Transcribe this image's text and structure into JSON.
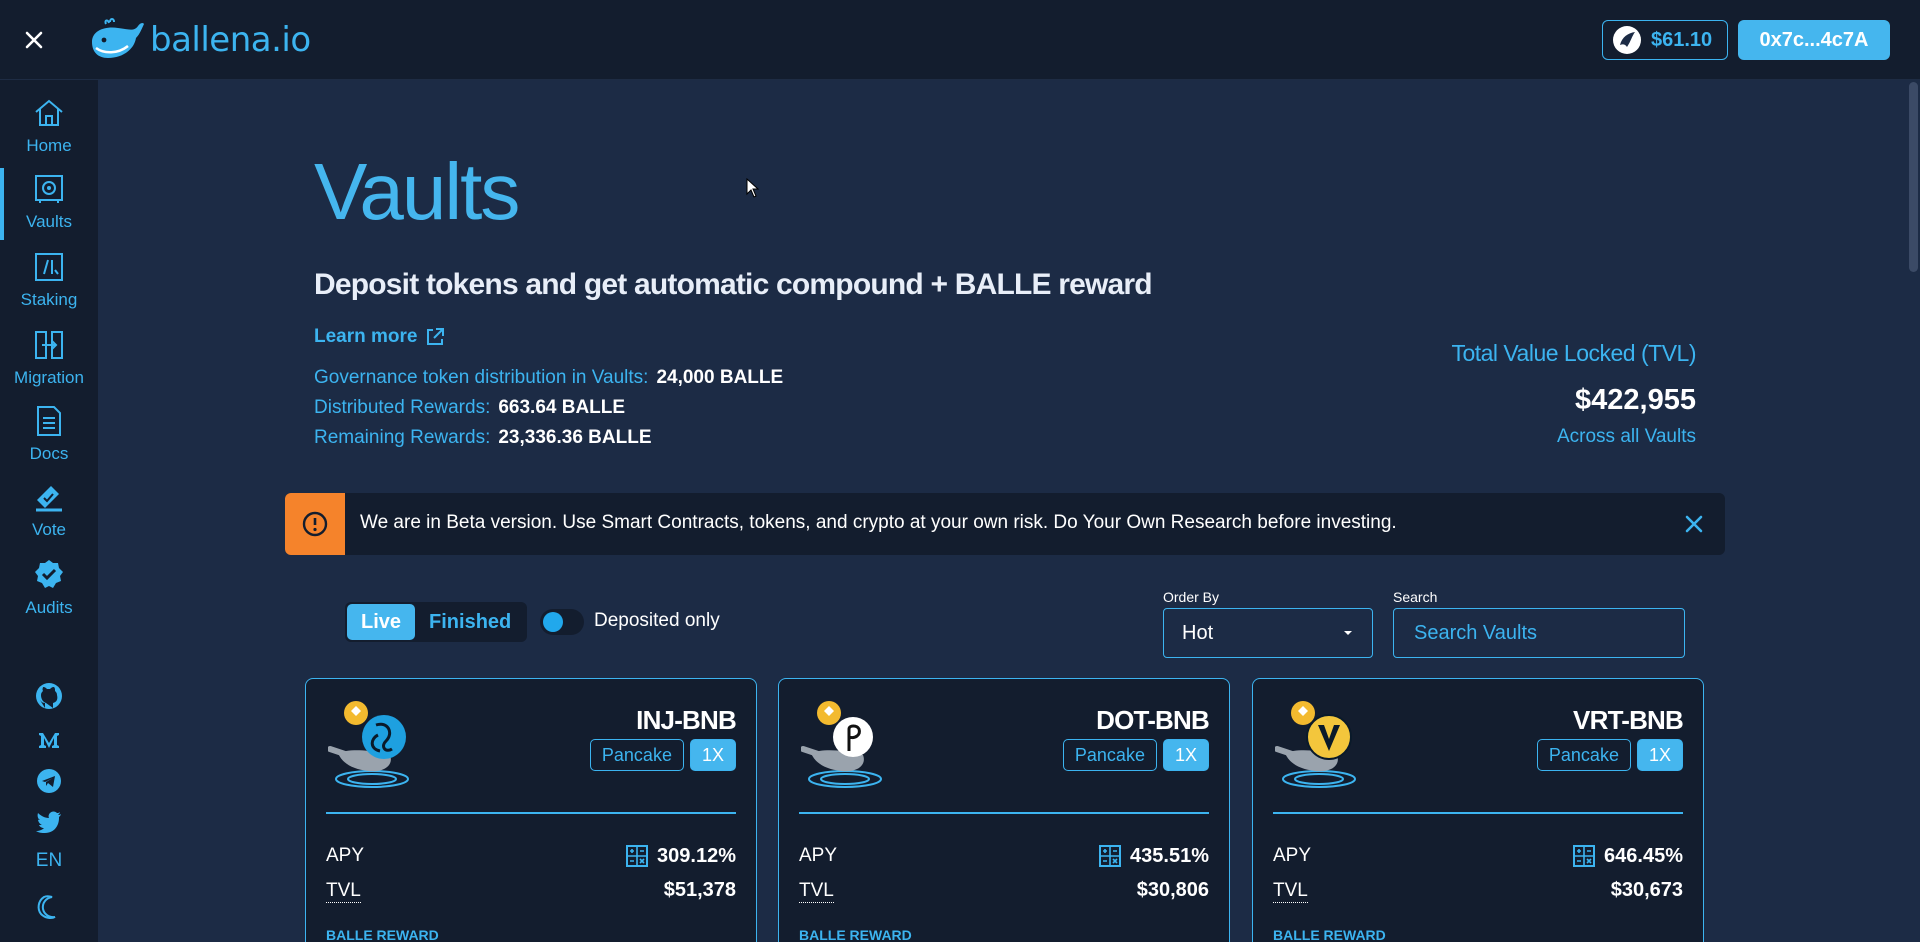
{
  "header": {
    "brand": "ballena.io",
    "price": "$61.10",
    "wallet": "0x7c...4c7A"
  },
  "sidebar": {
    "items": [
      {
        "label": "Home",
        "icon": "home-icon"
      },
      {
        "label": "Vaults",
        "icon": "vault-icon"
      },
      {
        "label": "Staking",
        "icon": "staking-icon"
      },
      {
        "label": "Migration",
        "icon": "migration-icon"
      },
      {
        "label": "Docs",
        "icon": "docs-icon"
      },
      {
        "label": "Vote",
        "icon": "vote-icon"
      },
      {
        "label": "Audits",
        "icon": "audits-icon"
      }
    ],
    "social": [
      "github-icon",
      "medium-icon",
      "telegram-icon",
      "twitter-icon"
    ],
    "language": "EN"
  },
  "page": {
    "title": "Vaults",
    "subtitle": "Deposit tokens and get automatic compound + BALLE reward",
    "learn_more": "Learn more",
    "stats": [
      {
        "label": "Governance token distribution in Vaults:",
        "value": "24,000 BALLE"
      },
      {
        "label": "Distributed Rewards:",
        "value": "663.64 BALLE"
      },
      {
        "label": "Remaining Rewards:",
        "value": "23,336.36 BALLE"
      }
    ],
    "tvl": {
      "label": "Total Value Locked (TVL)",
      "value": "$422,955",
      "sub": "Across all Vaults"
    }
  },
  "banner": {
    "text": "We are in Beta version. Use Smart Contracts, tokens, and crypto at your own risk. Do Your Own Research before investing."
  },
  "filters": {
    "live": "Live",
    "finished": "Finished",
    "deposited_only": "Deposited only",
    "order_by_label": "Order By",
    "order_by_value": "Hot",
    "search_label": "Search",
    "search_placeholder": "Search Vaults"
  },
  "vaults": [
    {
      "name": "INJ-BNB",
      "platform": "Pancake",
      "multiplier": "1X",
      "apy_label": "APY",
      "apy": "309.12%",
      "tvl_label": "TVL",
      "tvl": "$51,378",
      "reward_label": "BALLE REWARD",
      "token_color": "#1ea0e0"
    },
    {
      "name": "DOT-BNB",
      "platform": "Pancake",
      "multiplier": "1X",
      "apy_label": "APY",
      "apy": "435.51%",
      "tvl_label": "TVL",
      "tvl": "$30,806",
      "reward_label": "BALLE REWARD",
      "token_color": "#ffffff"
    },
    {
      "name": "VRT-BNB",
      "platform": "Pancake",
      "multiplier": "1X",
      "apy_label": "APY",
      "apy": "646.45%",
      "tvl_label": "TVL",
      "tvl": "$30,673",
      "reward_label": "BALLE REWARD",
      "token_color": "#f3c63c"
    }
  ]
}
